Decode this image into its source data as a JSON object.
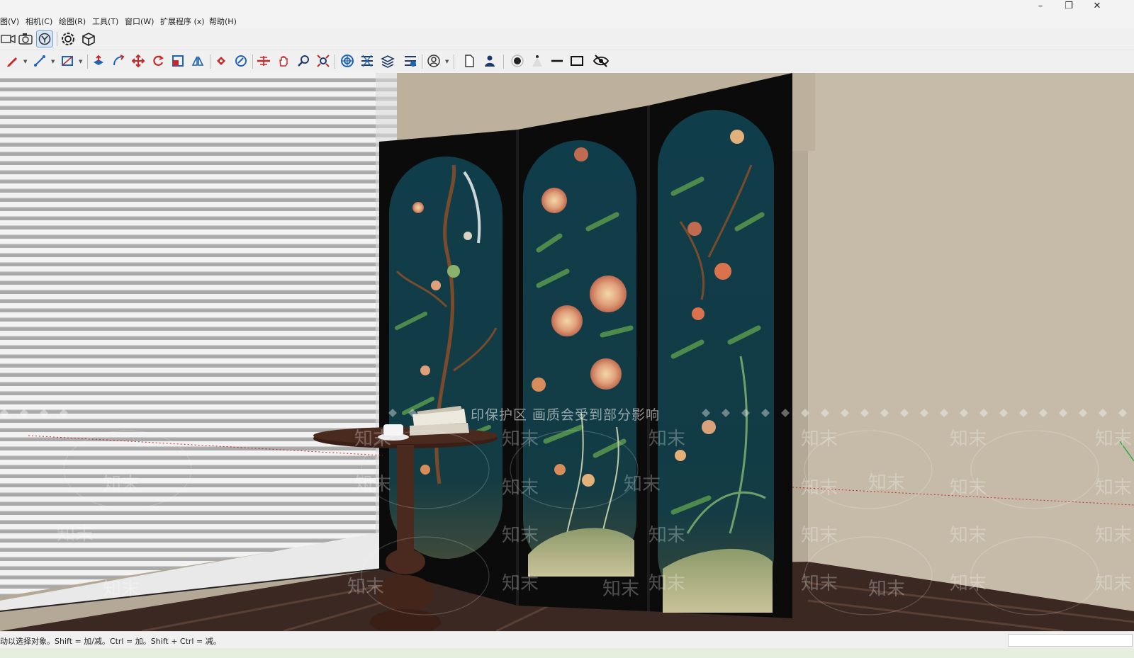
{
  "window": {
    "minimize_glyph": "–",
    "restore_glyph": "❐",
    "close_glyph": "✕"
  },
  "menu": {
    "items": [
      "图(V)",
      "相机(C)",
      "绘图(R)",
      "工具(T)",
      "窗口(W)",
      "扩展程序 (x)",
      "帮助(H)"
    ]
  },
  "toolbar_top": {
    "icons": [
      "camera-video-icon",
      "camera-snapshot-icon",
      "orbit-icon",
      "gear-flower-icon",
      "box-export-icon"
    ]
  },
  "toolbar_main": {
    "icons": [
      "pencil-icon",
      "line-icon",
      "rectangle-icon",
      "push-pull-icon",
      "follow-me-icon",
      "move-icon",
      "rotate-icon",
      "scale-icon",
      "mirror-icon",
      "paint-bucket-icon",
      "eraser-icon",
      "section-plane-icon",
      "hand-pan-icon",
      "zoom-icon",
      "zoom-extents-icon",
      "component-icon",
      "layers-icon",
      "stack-icon",
      "scenes-icon",
      "user-circle-icon",
      "page-icon",
      "person-icon",
      "dot-light-icon",
      "cone-icon",
      "line-weight-icon",
      "frame-icon",
      "hide-eye-icon"
    ]
  },
  "viewport": {
    "watermark_banner": "印保护区 画质会受到部分影响",
    "watermark_tile": "知末"
  },
  "status": {
    "text": "动以选择对象。Shift = 加/减。Ctrl = 加。Shift + Ctrl = 减。",
    "measurement_value": ""
  },
  "colors": {
    "wall": "#b2a795",
    "screen_frame": "#0b0b0b",
    "panel_teal": "#0f3d4a",
    "floor": "#3d2a24",
    "blinds": "#e6e6e6",
    "table_wood": "#4a2a1e"
  }
}
